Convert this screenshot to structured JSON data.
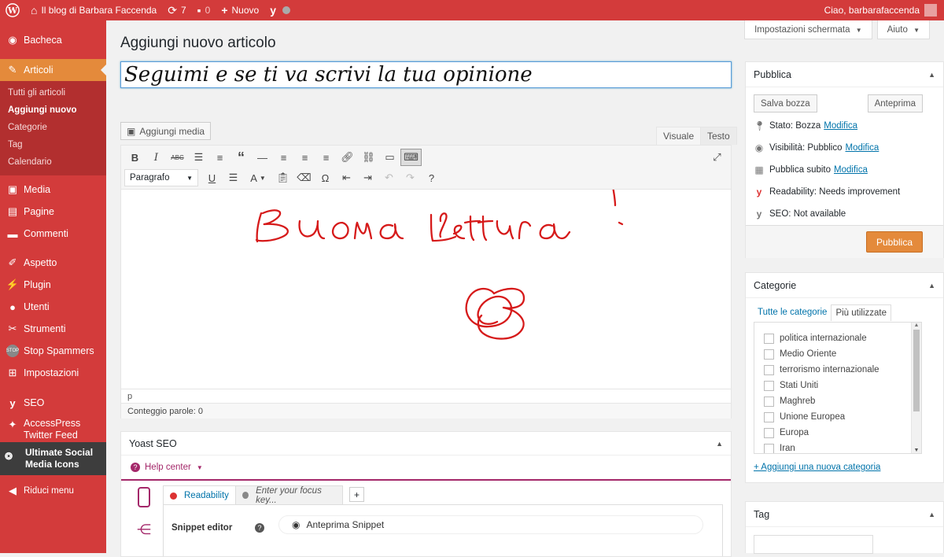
{
  "adminbar": {
    "site_name": "Il blog di Barbara Faccenda",
    "updates_count": "7",
    "comments_count": "0",
    "new_label": "Nuovo",
    "greeting": "Ciao, barbarafaccenda"
  },
  "sidebar": {
    "items": [
      {
        "label": "Bacheca",
        "icon": "dashboard-icon"
      },
      {
        "label": "Articoli",
        "icon": "pin-icon"
      },
      {
        "label": "Media",
        "icon": "media-icon"
      },
      {
        "label": "Pagine",
        "icon": "pages-icon"
      },
      {
        "label": "Commenti",
        "icon": "comments-icon"
      },
      {
        "label": "Aspetto",
        "icon": "appearance-icon"
      },
      {
        "label": "Plugin",
        "icon": "plugins-icon"
      },
      {
        "label": "Utenti",
        "icon": "users-icon"
      },
      {
        "label": "Strumenti",
        "icon": "tools-icon"
      },
      {
        "label": "Stop Spammers",
        "icon": "stop-icon"
      },
      {
        "label": "Impostazioni",
        "icon": "settings-icon"
      },
      {
        "label": "SEO",
        "icon": "yoast-icon"
      },
      {
        "label": "AccessPress Twitter Feed",
        "icon": "twitter-icon"
      },
      {
        "label": "Ultimate Social Media Icons",
        "icon": "social-icon"
      },
      {
        "label": "Riduci menu",
        "icon": "collapse-icon"
      }
    ],
    "submenu": [
      "Tutti gli articoli",
      "Aggiungi nuovo",
      "Categorie",
      "Tag",
      "Calendario"
    ]
  },
  "screen_options": "Impostazioni schermata",
  "help": "Aiuto",
  "page_title": "Aggiungi nuovo articolo",
  "post_title": "Seguimi e se ti va scrivi la tua opinione",
  "add_media": "Aggiungi media",
  "tabs": {
    "visual": "Visuale",
    "text": "Testo"
  },
  "format_select": "Paragrafo",
  "status_path": "p",
  "word_count": "Conteggio parole: 0",
  "yoast": {
    "title": "Yoast SEO",
    "help_center": "Help center",
    "readability_tab": "Readability",
    "focus_placeholder": "Enter your focus key...",
    "snippet_label": "Snippet editor",
    "snippet_preview": "Anteprima Snippet"
  },
  "publish": {
    "title": "Pubblica",
    "save_draft": "Salva bozza",
    "preview": "Anteprima",
    "status_label": "Stato:",
    "status_value": "Bozza",
    "visibility_label": "Visibilità:",
    "visibility_value": "Pubblico",
    "schedule_label": "Pubblica",
    "schedule_value": "subito",
    "edit_link": "Modifica",
    "readability_label": "Readability:",
    "readability_value": "Needs improvement",
    "seo_label": "SEO:",
    "seo_value": "Not available",
    "publish_button": "Pubblica"
  },
  "categories": {
    "title": "Categorie",
    "tab_all": "Tutte le categorie",
    "tab_most_used": "Più utilizzate",
    "items": [
      "politica internazionale",
      "Medio Oriente",
      "terrorismo internazionale",
      "Stati Uniti",
      "Maghreb",
      "Unione Europea",
      "Europa",
      "Iran"
    ],
    "add_new": "+ Aggiungi una nuova categoria"
  },
  "tags": {
    "title": "Tag"
  },
  "colors": {
    "admin_red": "#d33b3b",
    "accent_orange": "#e48a3b",
    "yoast_purple": "#a4286a",
    "link_blue": "#0073aa",
    "ink_red": "#d61a1a"
  }
}
